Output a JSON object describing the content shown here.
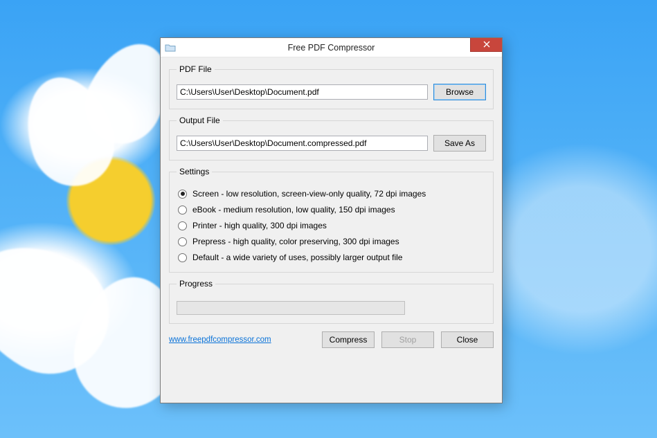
{
  "window": {
    "title": "Free PDF Compressor"
  },
  "pdf_file": {
    "group_label": "PDF File",
    "path": "C:\\Users\\User\\Desktop\\Document.pdf",
    "browse_label": "Browse"
  },
  "output_file": {
    "group_label": "Output File",
    "path": "C:\\Users\\User\\Desktop\\Document.compressed.pdf",
    "save_as_label": "Save As"
  },
  "settings": {
    "group_label": "Settings",
    "options": [
      "Screen - low resolution, screen-view-only quality, 72 dpi images",
      "eBook - medium resolution, low quality, 150 dpi images",
      "Printer - high quality, 300 dpi images",
      "Prepress - high quality, color preserving, 300 dpi images",
      "Default - a wide variety of uses, possibly larger output file"
    ],
    "selected_index": 0
  },
  "progress": {
    "group_label": "Progress"
  },
  "footer": {
    "website_label": "www.freepdfcompressor.com",
    "compress_label": "Compress",
    "stop_label": "Stop",
    "close_label": "Close"
  }
}
